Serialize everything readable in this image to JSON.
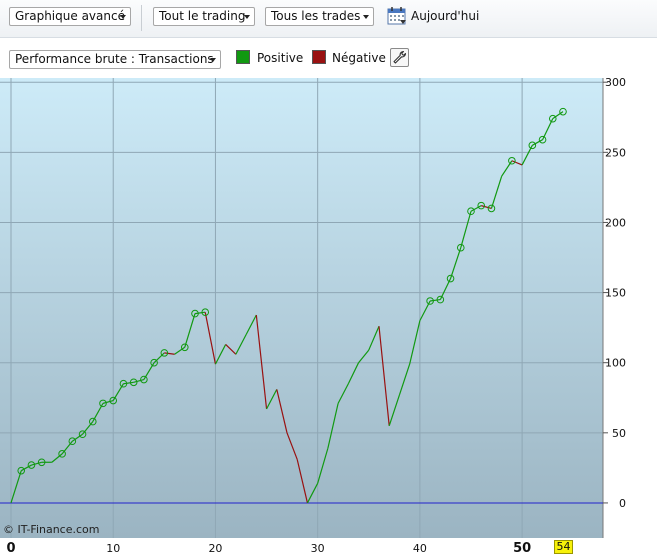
{
  "toolbar": {
    "chart_mode": "Graphique avancé",
    "period": "Tout le trading",
    "trades_filter": "Tous les trades",
    "today_label": "Aujourd'hui"
  },
  "toolbar2": {
    "metric": "Performance brute : Transactions",
    "legend_positive": "Positive",
    "legend_negative": "Négative"
  },
  "colors": {
    "positive": "#119911",
    "negative": "#991111",
    "zero_line": "#2222cc",
    "plot_bg_top": "#cdebf8",
    "plot_bg_bottom": "#9bb4c2"
  },
  "footer": {
    "copyright": "© IT-Finance.com",
    "last_trade_label": "54"
  },
  "chart_data": {
    "type": "line",
    "xlim": [
      0,
      54
    ],
    "ylim": [
      -25,
      303
    ],
    "x_ticks": [
      0,
      10,
      20,
      30,
      40,
      50
    ],
    "y_ticks": [
      0,
      50,
      100,
      150,
      200,
      250,
      300
    ],
    "grid": true,
    "y_axis_side": "right",
    "marked_points": [
      1,
      2,
      3,
      5,
      6,
      7,
      8,
      9,
      10,
      11,
      12,
      13,
      14,
      15,
      17,
      18,
      19,
      41,
      42,
      43,
      44,
      45,
      46,
      47,
      49,
      51,
      52,
      53,
      54
    ],
    "x": [
      0,
      1,
      2,
      3,
      4,
      5,
      6,
      7,
      8,
      9,
      10,
      11,
      12,
      13,
      14,
      15,
      16,
      17,
      18,
      19,
      20,
      21,
      22,
      23,
      24,
      25,
      26,
      27,
      28,
      29,
      30,
      31,
      32,
      33,
      34,
      35,
      36,
      37,
      38,
      39,
      40,
      41,
      42,
      43,
      44,
      45,
      46,
      47,
      48,
      49,
      50,
      51,
      52,
      53,
      54
    ],
    "y": [
      0,
      23,
      27,
      29,
      29,
      35,
      44,
      49,
      58,
      71,
      73,
      85,
      86,
      88,
      100,
      107,
      106,
      111,
      135,
      136,
      99,
      113,
      106,
      120,
      134,
      67,
      81,
      50,
      31,
      0,
      14,
      39,
      71,
      85,
      100,
      109,
      126,
      55,
      77,
      99,
      130,
      144,
      145,
      160,
      182,
      208,
      212,
      210,
      233,
      244,
      241,
      255,
      259,
      274,
      279
    ]
  }
}
